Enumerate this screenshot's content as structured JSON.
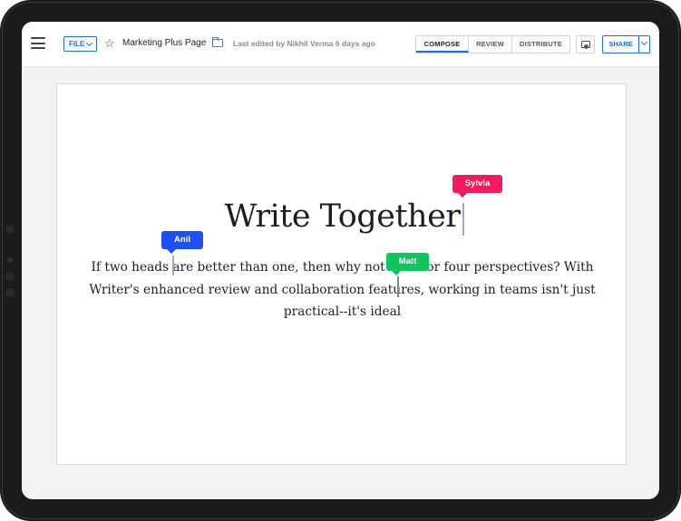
{
  "toolbar": {
    "file_label": "FILE",
    "doc_title": "Marketing Plus Page",
    "last_edited": "Last edited by Nikhil Verma 6 days ago",
    "tabs": [
      {
        "label": "COMPOSE",
        "active": true
      },
      {
        "label": "REVIEW",
        "active": false
      },
      {
        "label": "DISTRIBUTE",
        "active": false
      }
    ],
    "share_label": "SHARE",
    "icons": [
      "hamburger-menu-icon",
      "star-icon",
      "folder-icon",
      "comment-icon",
      "chevron-down-icon"
    ]
  },
  "document": {
    "heading": "Write Together",
    "body": "If two heads are better than one, then why not three or four perspectives? With Writer's enhanced review and collaboration features, working in teams isn't just practical--it's ideal"
  },
  "collaborators": [
    {
      "name": "Sylvia",
      "color": "#ee1c5c"
    },
    {
      "name": "Anil",
      "color": "#1e4ff0"
    },
    {
      "name": "Matt",
      "color": "#12c45d"
    }
  ],
  "colors": {
    "accent": "#1f6ed4",
    "device_frame": "#1b1b1d",
    "canvas_bg": "#f3f3f3"
  }
}
